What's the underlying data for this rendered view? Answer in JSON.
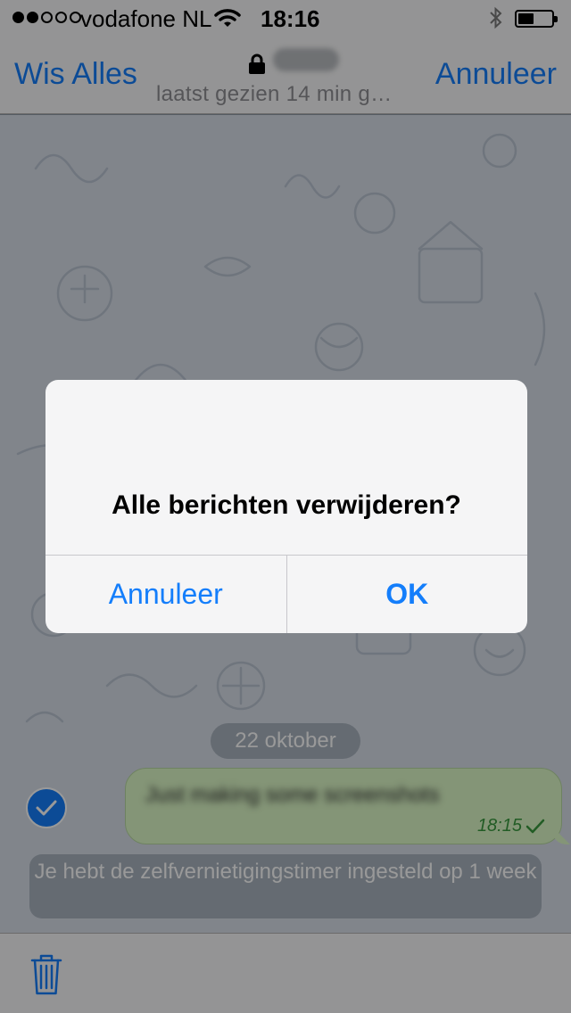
{
  "status_bar": {
    "carrier": "vodafone NL",
    "time": "18:16",
    "signal_bars_filled": 2,
    "signal_bars_total": 5,
    "battery_level": 0.42
  },
  "nav": {
    "left_label": "Wis Alles",
    "right_label": "Annuleer",
    "subtitle": "laatst gezien 14 min g…"
  },
  "chat": {
    "date": "22 oktober",
    "message": {
      "time": "18:15"
    },
    "system_message": "Je hebt de zelfvernietigingstimer ingesteld op 1 week"
  },
  "alert": {
    "title": "Alle berichten verwijderen?",
    "cancel_label": "Annuleer",
    "ok_label": "OK"
  },
  "colors": {
    "accent": "#147efb",
    "bubble": "#dcf8c6",
    "check_green": "#3a9a3f"
  },
  "icons": {
    "lock": "lock-icon",
    "trash": "trash-icon",
    "wifi": "wifi-icon",
    "bluetooth": "bluetooth-icon",
    "checkmark": "checkmark-icon"
  }
}
